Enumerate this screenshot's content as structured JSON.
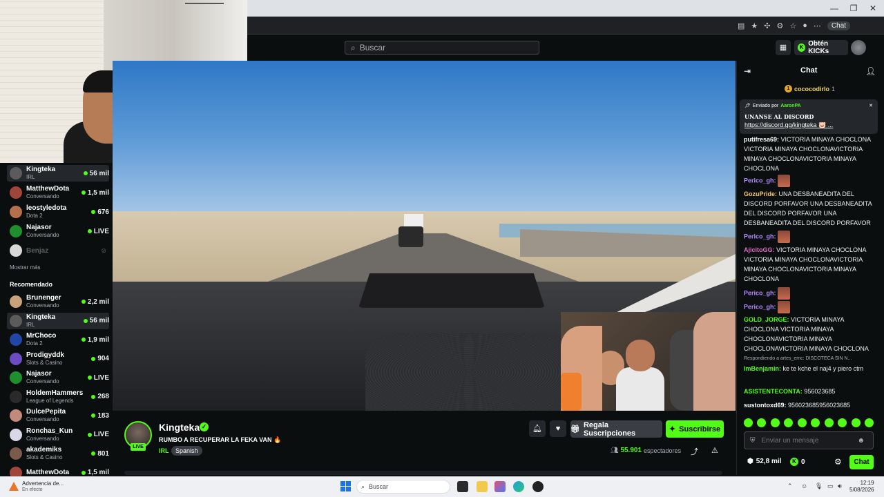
{
  "browser": {
    "chat_chip": "Chat"
  },
  "header": {
    "search_placeholder": "Buscar",
    "kicks_button": "Obtén KICKs"
  },
  "sidebar": {
    "following": [
      {
        "name": "Kingteka",
        "sub": "IRL",
        "viewers": "56 mil",
        "active": true,
        "color": "#5b5b5b"
      },
      {
        "name": "MatthewDota",
        "sub": "Conversando",
        "viewers": "1,5 mil",
        "color": "#a0453a"
      },
      {
        "name": "leostyledota",
        "sub": "Dota 2",
        "viewers": "676",
        "color": "#b56f4d"
      },
      {
        "name": "Najasor",
        "sub": "Conversando",
        "viewers": "LIVE",
        "color": "#1f8f2e"
      },
      {
        "name": "Benjaz",
        "sub": "",
        "viewers": "",
        "offline": true,
        "color": "#d8d8d8"
      }
    ],
    "show_more": "Mostrar más",
    "recommended_title": "Recomendado",
    "recommended": [
      {
        "name": "Brunenger",
        "sub": "Conversando",
        "viewers": "2,2 mil",
        "color": "#c9a27b"
      },
      {
        "name": "Kingteka",
        "sub": "IRL",
        "viewers": "56 mil",
        "active": true,
        "color": "#5b5b5b"
      },
      {
        "name": "MrChoco",
        "sub": "Dota 2",
        "viewers": "1,9 mil",
        "color": "#2146a8"
      },
      {
        "name": "Prodigyddk",
        "sub": "Slots & Casino",
        "viewers": "904",
        "color": "#6b4cc2"
      },
      {
        "name": "Najasor",
        "sub": "Conversando",
        "viewers": "LIVE",
        "color": "#1f8f2e"
      },
      {
        "name": "HoldemHammers",
        "sub": "League of Legends",
        "viewers": "268",
        "color": "#2a2a2a"
      },
      {
        "name": "DulcePepita",
        "sub": "Conversando",
        "viewers": "183",
        "color": "#c28a7a"
      },
      {
        "name": "Ronchas_Kun",
        "sub": "Conversando",
        "viewers": "LIVE",
        "color": "#d8d8e8"
      },
      {
        "name": "akademiks",
        "sub": "Slots & Casino",
        "viewers": "801",
        "color": "#7a5a4a"
      },
      {
        "name": "MatthewDota",
        "sub": "",
        "viewers": "1,5 mil",
        "color": "#a0453a"
      }
    ]
  },
  "stream": {
    "streamer": "Kingteka",
    "live_badge": "LIVE",
    "title": "RUMBO A RECUPERAR LA FEKA VAN 🔥",
    "category": "IRL",
    "language": "Spanish",
    "gift_label": "Regala Suscripciones",
    "subscribe_label": "Suscribirse",
    "viewers": "55.901",
    "viewers_suffix": "espectadores"
  },
  "chat": {
    "title": "Chat",
    "leader_name": "cococodirlo",
    "leader_count": "1",
    "pinned_by_label": "Enviado por",
    "pinned_by": "AaronPA",
    "pinned_title": "UNANSE AL DISCORD",
    "pinned_link": "https://discord.gg/kingteka 🐷 ...",
    "messages": [
      {
        "user": "putifresa69:",
        "color": "#ffffff",
        "text": "VICTORIA MINAYA CHOCLONA VICTORIA MINAYA CHOCLONAVICTORIA MINAYA CHOCLONAVICTORIA MINAYA CHOCLONA"
      },
      {
        "user": "Perico_gh:",
        "color": "#b48cff",
        "text": ""
      },
      {
        "user": "GozuPride:",
        "color": "#f6c870",
        "text": "UNA DESBANEADITA DEL DISCORD PORFAVOR UNA DESBANEADITA DEL DISCORD PORFAVOR UNA DESBANEADITA DEL DISCORD PORFAVOR"
      },
      {
        "user": "Perico_gh:",
        "color": "#b48cff",
        "text": ""
      },
      {
        "user": "AjicitoGG:",
        "color": "#e06ec2",
        "text": "VICTORIA MINAYA CHOCLONA VICTORIA MINAYA CHOCLONAVICTORIA MINAYA CHOCLONAVICTORIA MINAYA CHOCLONA"
      },
      {
        "user": "Perico_gh:",
        "color": "#b48cff",
        "text": ""
      },
      {
        "user": "Perico_gh:",
        "color": "#b48cff",
        "text": ""
      },
      {
        "user": "GOLD_JORGE:",
        "color": "#53fc18",
        "text": "VICTORIA MINAYA CHOCLONA VICTORIA MINAYA CHOCLONAVICTORIA MINAYA CHOCLONAVICTORIA MINAYA CHOCLONA"
      },
      {
        "user": "ImBenjamin:",
        "color": "#53fc18",
        "text": "ke te kche el naj4 y piero ctm"
      },
      {
        "user": "ASISTENTECONTA:",
        "color": "#53fc18",
        "text": "956023685"
      },
      {
        "user": "sustontoxd69:",
        "color": "#ffffff",
        "text": "956023685956023685"
      }
    ],
    "reply_to": "Respondiendo a artes_emc: DISCOTECA SIN N...",
    "input_placeholder": "Enviar un mensaje",
    "points": "52,8 mil",
    "kick_points": "0",
    "send_label": "Chat"
  },
  "taskbar": {
    "warning_title": "Advertencia de...",
    "warning_sub": "En efecto",
    "search_label": "Buscar",
    "time": "12:19",
    "date": "5/08/2026"
  },
  "colors": {
    "accent": "#53fc18",
    "bg": "#0b0e0f"
  }
}
